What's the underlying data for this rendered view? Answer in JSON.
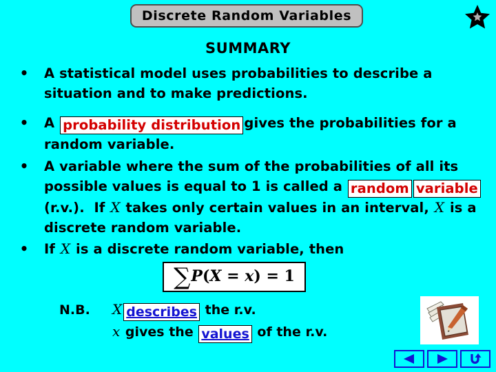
{
  "slide": {
    "background_color": "#00ffff",
    "title": "Discrete Random Variables",
    "heading": "SUMMARY"
  },
  "colors": {
    "background": "#00ffff",
    "title_bar": "#c0c0c0",
    "keyword_red": "#d40000",
    "keyword_blue": "#1414d2",
    "text": "#000000",
    "box_fill": "#ffffff"
  },
  "icons": {
    "star": "star-icon",
    "notepad": "notepad-pencil-icon",
    "nav_back": "triangle-left-icon",
    "nav_forward": "triangle-right-icon",
    "nav_return": "u-turn-arrow-icon"
  },
  "bullets": [
    {
      "marker": "•",
      "segments": [
        {
          "type": "text",
          "value": "A statistical model uses probabilities to describe a situation and to make predictions."
        }
      ]
    },
    {
      "marker": "•",
      "segments": [
        {
          "type": "text",
          "value": "A "
        },
        {
          "type": "keyword_red",
          "value": "probability distribution"
        },
        {
          "type": "text",
          "value": " gives the probabilities for a random variable."
        }
      ]
    },
    {
      "marker": "•",
      "segments": [
        {
          "type": "text",
          "value": "A variable where the sum of the probabilities of all its possible values is equal to 1 is called a "
        },
        {
          "type": "keyword_red",
          "value": "random"
        },
        {
          "type": "keyword_red2",
          "value": "variable"
        },
        {
          "type": "text",
          "value": " (r.v.).  If "
        },
        {
          "type": "mathvar",
          "value": "X"
        },
        {
          "type": "text",
          "value": " takes only certain values in an interval, "
        },
        {
          "type": "mathvar",
          "value": "X"
        },
        {
          "type": "text",
          "value": " is a discrete random variable."
        }
      ]
    },
    {
      "marker": "•",
      "segments": [
        {
          "type": "text",
          "value": "If "
        },
        {
          "type": "mathvar",
          "value": "X"
        },
        {
          "type": "text",
          "value": " is a discrete random variable, then"
        }
      ]
    }
  ],
  "bullet_text": {
    "b1_line1": "A statistical model uses probabilities to describe a",
    "b1_line2": "situation and to make predictions.",
    "b2_pre": "A ",
    "b2_keyword": "probability distribution",
    "b2_post": "gives the probabilities for",
    "b2_line2": "a random variable.",
    "b3_line1": "A variable where the sum of the probabilities of all",
    "b3_line2_pre": "its possible values is equal to 1 is called a ",
    "b3_keyword1": "random",
    "b3_keyword2": "variable",
    "b3_line3_mid": " (r.v.).  If ",
    "b3_var1": "X",
    "b3_line3_post": " takes only certain values in an",
    "b3_line4_pre": "interval, ",
    "b3_var2": "X",
    "b3_line4_post": " is a discrete random variable.",
    "b4_pre": "If ",
    "b4_var": "X",
    "b4_post": " is a discrete random variable, then"
  },
  "formula": {
    "sigma": "∑",
    "p": "P",
    "open": "(",
    "var_x_upper": "X",
    "equals": " = ",
    "var_x_lower": "x",
    "close": ")",
    "equals2": " = ",
    "one": "1",
    "full": "∑ P(X = x) = 1"
  },
  "nb": {
    "label": "N.B.",
    "line1_var": "X",
    "line1_keyword": "describes",
    "line1_post": " the r.v.",
    "line2_var": "x",
    "line2_pre": " gives the ",
    "line2_keyword": "values",
    "line2_post": " of the r.v."
  },
  "nav": {
    "back_label": "◀",
    "forward_label": "▶",
    "return_label": "↶"
  }
}
